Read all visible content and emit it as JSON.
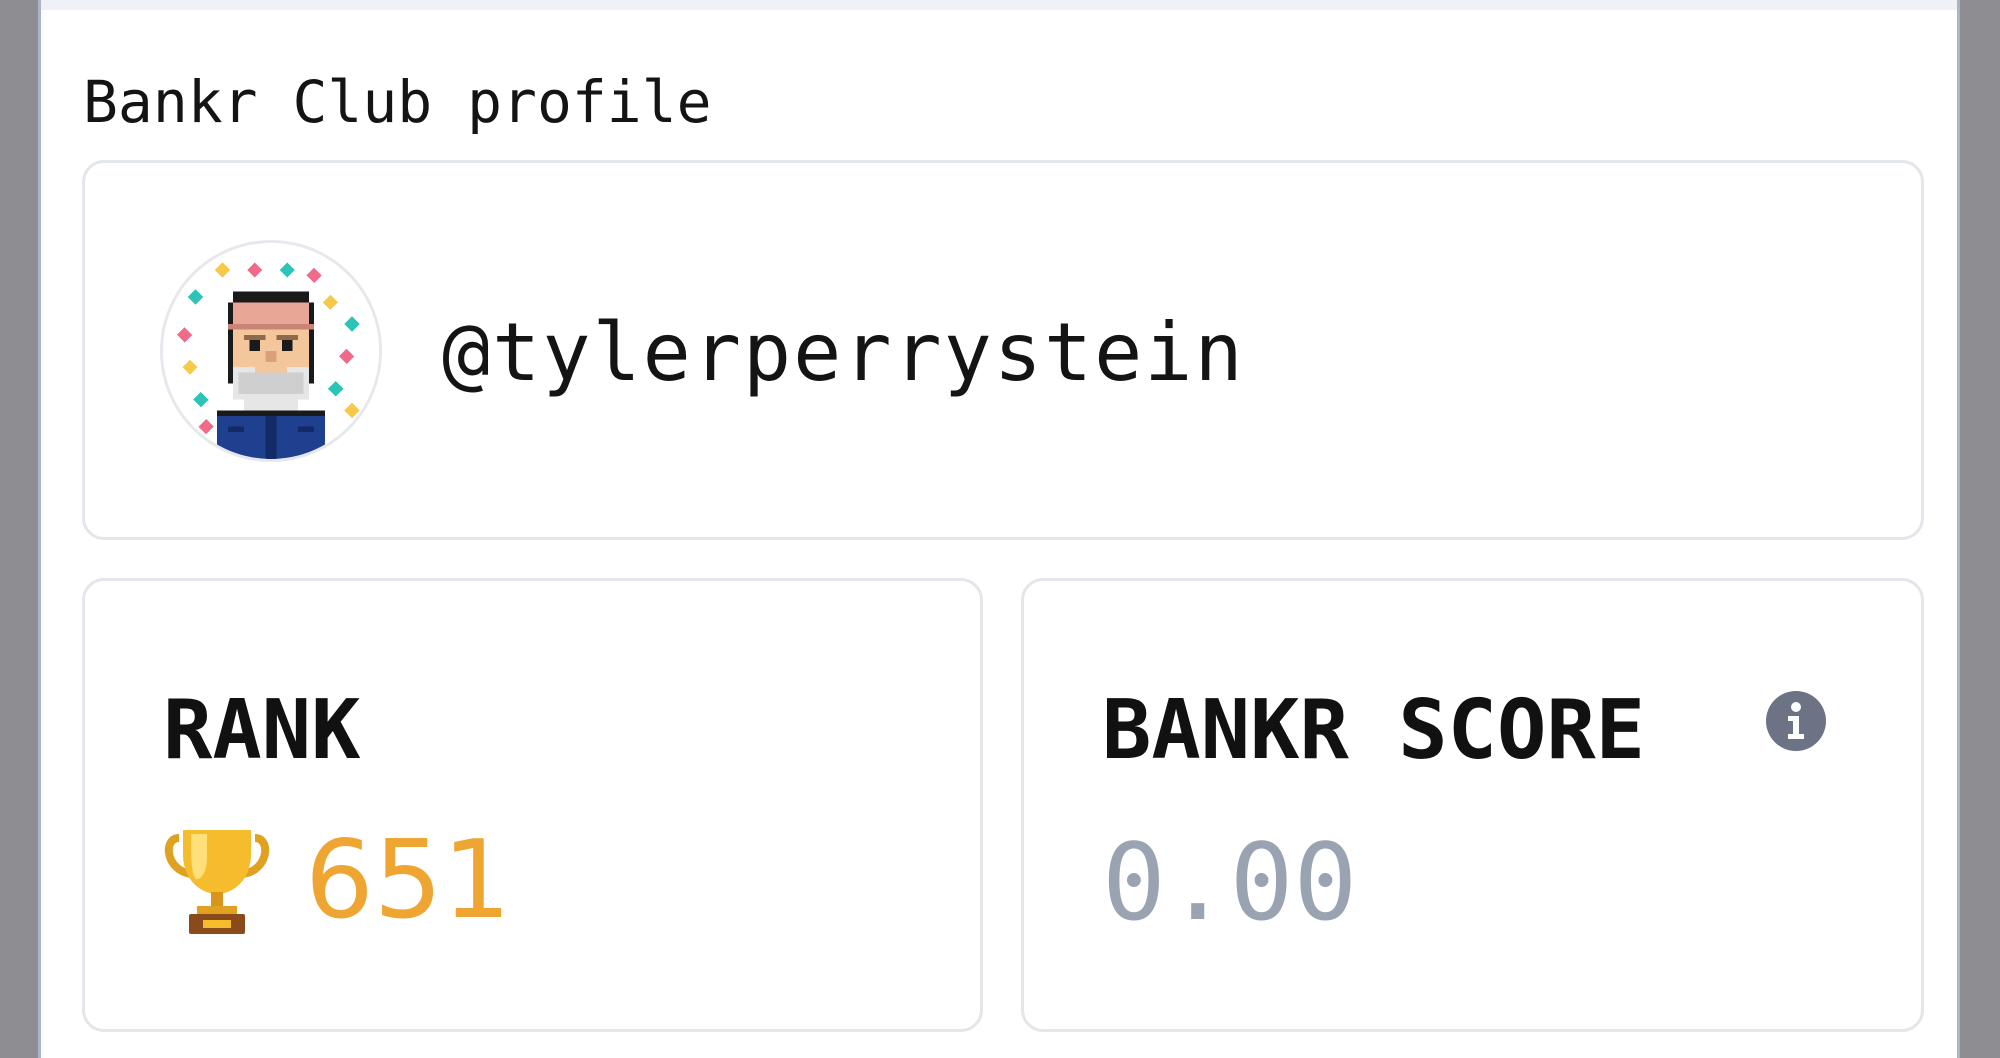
{
  "profile": {
    "section_title": "Bankr Club profile",
    "handle": "@tylerperrystein",
    "avatar_icon": "pixel-art-avatar"
  },
  "stats": {
    "rank": {
      "label": "RANK",
      "value": "651",
      "icon": "trophy-icon",
      "value_color": "#eea532"
    },
    "score": {
      "label": "BANKR SCORE",
      "value": "0.00",
      "icon": "info-icon",
      "value_color": "#9aa3b2"
    }
  }
}
